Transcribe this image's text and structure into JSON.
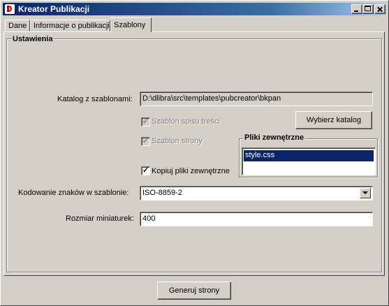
{
  "window": {
    "title": "Kreator Publikacji"
  },
  "tabs": [
    {
      "label": "Dane"
    },
    {
      "label": "Informacje o publikacji"
    },
    {
      "label": "Szablony",
      "selected": true
    }
  ],
  "settings": {
    "group_title": "Ustawienia",
    "template_dir_label": "Katalog z szablonami:",
    "template_dir_value": "D:\\dlibra\\src\\templates\\pubcreator\\bkpan",
    "choose_dir_button": "Wybierz katalog",
    "toc_template_label": "Szablon spisu treści",
    "toc_template_checked": true,
    "page_template_label": "Szablon strony",
    "page_template_checked": true,
    "copy_external_label": "Kopiuj pliki zewnętrzne",
    "copy_external_checked": true,
    "external_files_title": "Pliki zewnętrzne",
    "external_files": [
      "style.css"
    ],
    "encoding_label": "Kodowanie znaków w szablonie:",
    "encoding_value": "ISO-8859-2",
    "thumb_size_label": "Rozmiar miniaturek:",
    "thumb_size_value": "400"
  },
  "footer": {
    "generate_button": "Generuj strony"
  },
  "colors": {
    "title_start": "#0a246a",
    "title_end": "#a6caf0",
    "selection": "#0a246a",
    "face": "#d4d0c8"
  },
  "icons": {
    "app": "app-logo-icon",
    "check": "checkmark-icon",
    "dropdown": "chevron-down-icon"
  }
}
